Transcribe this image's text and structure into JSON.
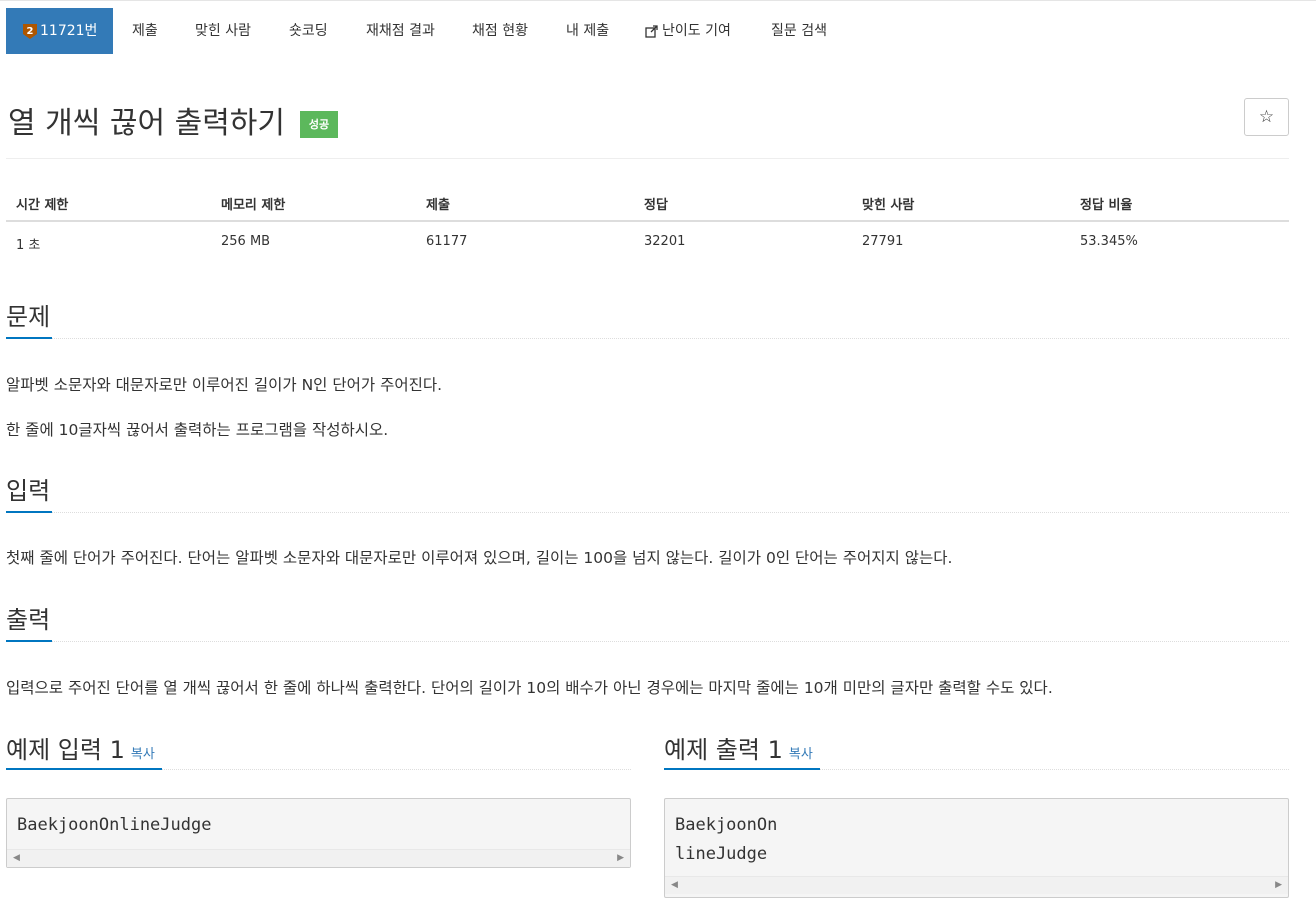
{
  "nav": {
    "problem_id": "11721번",
    "items": [
      "제출",
      "맞힌 사람",
      "숏코딩",
      "재채점 결과",
      "채점 현황",
      "내 제출",
      "난이도 기여",
      "질문 검색"
    ]
  },
  "problem": {
    "title": "열 개씩 끊어 출력하기",
    "status": "성공",
    "star": "☆"
  },
  "info": {
    "headers": [
      "시간 제한",
      "메모리 제한",
      "제출",
      "정답",
      "맞힌 사람",
      "정답 비율"
    ],
    "values": [
      "1 초",
      "256 MB",
      "61177",
      "32201",
      "27791",
      "53.345%"
    ]
  },
  "sections": {
    "description": {
      "heading": "문제",
      "paragraphs": [
        "알파벳 소문자와 대문자로만 이루어진 길이가 N인 단어가 주어진다.",
        "한 줄에 10글자씩 끊어서 출력하는 프로그램을 작성하시오."
      ]
    },
    "input": {
      "heading": "입력",
      "text": "첫째 줄에 단어가 주어진다. 단어는 알파벳 소문자와 대문자로만 이루어져 있으며, 길이는 100을 넘지 않는다. 길이가 0인 단어는 주어지지 않는다."
    },
    "output": {
      "heading": "출력",
      "text": "입력으로 주어진 단어를 열 개씩 끊어서 한 줄에 하나씩 출력한다. 단어의 길이가 10의 배수가 아닌 경우에는 마지막 줄에는 10개 미만의 글자만 출력할 수도 있다."
    }
  },
  "samples": {
    "input_heading": "예제 입력 1",
    "output_heading": "예제 출력 1",
    "copy_label": "복사",
    "input_text": "BaekjoonOnlineJudge",
    "output_text": "BaekjoonOn\nlineJudge"
  },
  "colors": {
    "nav_active": "#337ab7",
    "success": "#5cb85c",
    "section_underline": "#0076c0",
    "link": "#337ab7"
  }
}
